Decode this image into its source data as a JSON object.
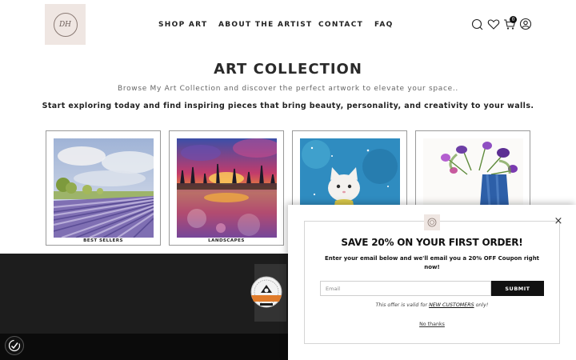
{
  "brand": {
    "logo_text": "DH"
  },
  "nav": {
    "items": [
      {
        "label": "SHOP ART"
      },
      {
        "label": "ABOUT THE ARTIST"
      },
      {
        "label": "CONTACT"
      },
      {
        "label": "FAQ"
      }
    ]
  },
  "header_icons": [
    "search-icon",
    "heart-icon",
    "cart-icon",
    "account-icon"
  ],
  "cart": {
    "count": "0"
  },
  "collection": {
    "title": "ART COLLECTION",
    "subtitle": "Browse My Art Collection and discover the perfect artwork to elevate your space..",
    "tagline": "Start exploring today and find inspiring pieces that bring beauty, personality, and creativity to your walls."
  },
  "cards": [
    {
      "caption": "BEST SELLERS",
      "art": "lavender-field-painting"
    },
    {
      "caption": "LANDSCAPES",
      "art": "sunset-lake-painting"
    },
    {
      "caption": "",
      "art": "cat-painting"
    },
    {
      "caption": "",
      "art": "flower-vase-painting"
    }
  ],
  "popup": {
    "title": "SAVE 20% ON YOUR FIRST ORDER!",
    "description": "Enter your email below and we'll email you a 20% OFF Coupon right now!",
    "email_placeholder": "Email",
    "submit_label": "SUBMIT",
    "note_prefix": "This offer is valid for ",
    "note_link": "NEW CUSTOMERS",
    "note_suffix": " only!",
    "dismiss_label": "No thanks",
    "close_glyph": "×"
  },
  "colors": {
    "accent": "#111111",
    "logo_bg": "#efe6e2",
    "band": "#1d1d1d",
    "footer": "#0b0b0b",
    "seal_orange": "#e07b2a"
  }
}
